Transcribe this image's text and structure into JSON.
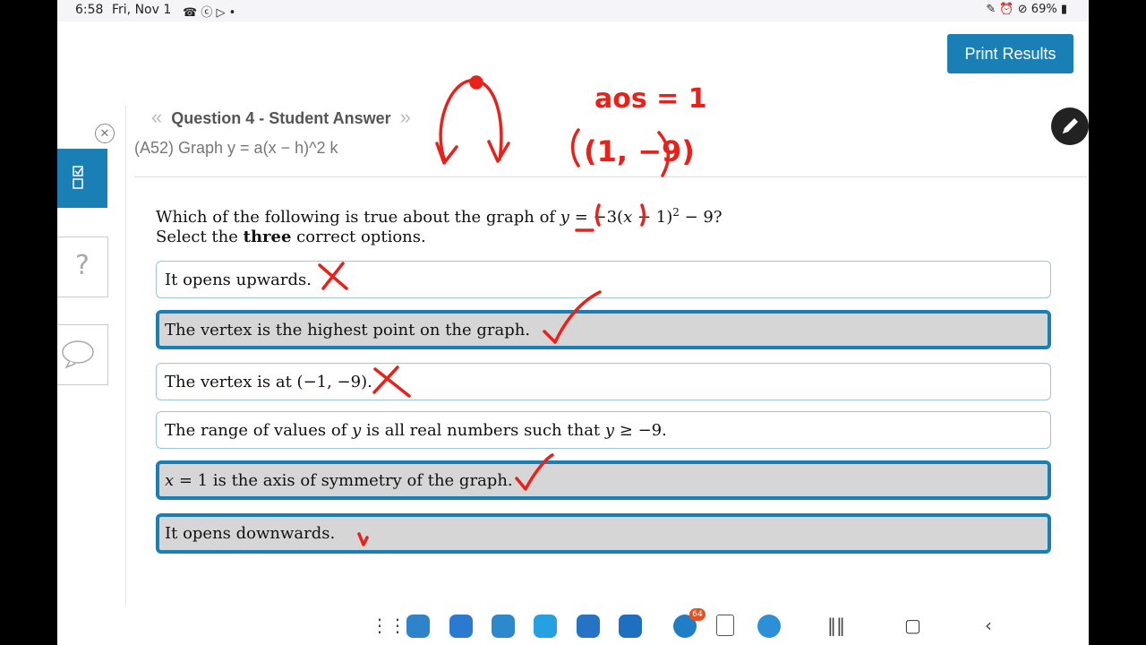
{
  "status": {
    "time": "6:58",
    "date": "Fri, Nov 1",
    "left_icons": "☎ ⓒ ▷  •",
    "right_icons": "✎ ⏰ ⊘",
    "battery": "69%"
  },
  "header": {
    "print_label": "Print Results"
  },
  "nav": {
    "prev": "«",
    "title": "Question 4 - Student Answer",
    "next": "»",
    "subtitle": "(A52) Graph y = a(x − h)^2 k"
  },
  "rail": {
    "close": "✕",
    "help": "?"
  },
  "question": {
    "prefix": "Which of the following is true about the graph of ",
    "equation_y": "y",
    "equation_mid": " = −3(",
    "equation_x": "x",
    "equation_rest": " − 1)",
    "equation_exp": "2",
    "equation_end": " − 9?",
    "instruction_pre": "Select the ",
    "instruction_bold": "three",
    "instruction_post": " correct options."
  },
  "options": [
    {
      "text": "It opens upwards.",
      "selected": false
    },
    {
      "text": "The vertex is the highest point on the graph.",
      "selected": true
    },
    {
      "text": "The vertex is at (−1, −9).",
      "selected": false
    },
    {
      "text_a": "The range of values of ",
      "var1": "y",
      "text_b": " is all real numbers such that ",
      "var2": "y",
      "text_c": " ≥ −9.",
      "selected": false
    },
    {
      "var": "x",
      "text": " = 1 is the axis of symmetry of the graph.",
      "selected": true
    },
    {
      "text": "It opens downwards.",
      "selected": true
    }
  ],
  "annotations": {
    "aos": "aos = 1",
    "vertex": "(1, −9)",
    "color": "#e8221b"
  },
  "taskbar": {
    "badge_count": "64"
  },
  "colors": {
    "accent": "#1a7fb5",
    "selected_bg": "#d6d6d6",
    "ink": "#e8221b"
  }
}
